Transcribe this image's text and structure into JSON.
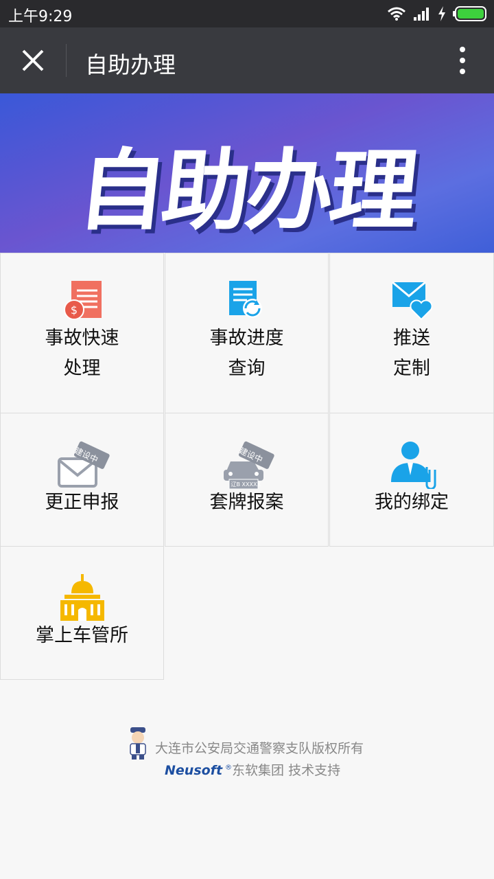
{
  "status": {
    "time": "上午9:29"
  },
  "header": {
    "title": "自助办理"
  },
  "banner": {
    "text": "自助办理"
  },
  "grid": [
    {
      "line1": "事故快速",
      "line2": "处理",
      "icon": "accident-bill-icon"
    },
    {
      "line1": "事故进度",
      "line2": "查询",
      "icon": "progress-query-icon"
    },
    {
      "line1": "推送",
      "line2": "定制",
      "icon": "mail-heart-icon"
    },
    {
      "line1": "更正申报",
      "badge": "建设中",
      "icon": "envelope-icon"
    },
    {
      "line1": "套牌报案",
      "badge": "建设中",
      "plate": "辽B XXXXX",
      "icon": "car-icon"
    },
    {
      "line1": "我的绑定",
      "icon": "person-clip-icon"
    },
    {
      "line1": "掌上车管所",
      "icon": "building-icon"
    }
  ],
  "footer": {
    "copyright": "大连市公安局交通警察支队版权所有",
    "brand": "Neusoft",
    "brand_mark": "®",
    "support": "东软集团 技术支持"
  },
  "colors": {
    "statusbar": "#2a2a2d",
    "titlebar": "#393a3f",
    "accent_blue": "#1aa3e8",
    "salmon": "#f07060",
    "gold": "#f5b800"
  }
}
